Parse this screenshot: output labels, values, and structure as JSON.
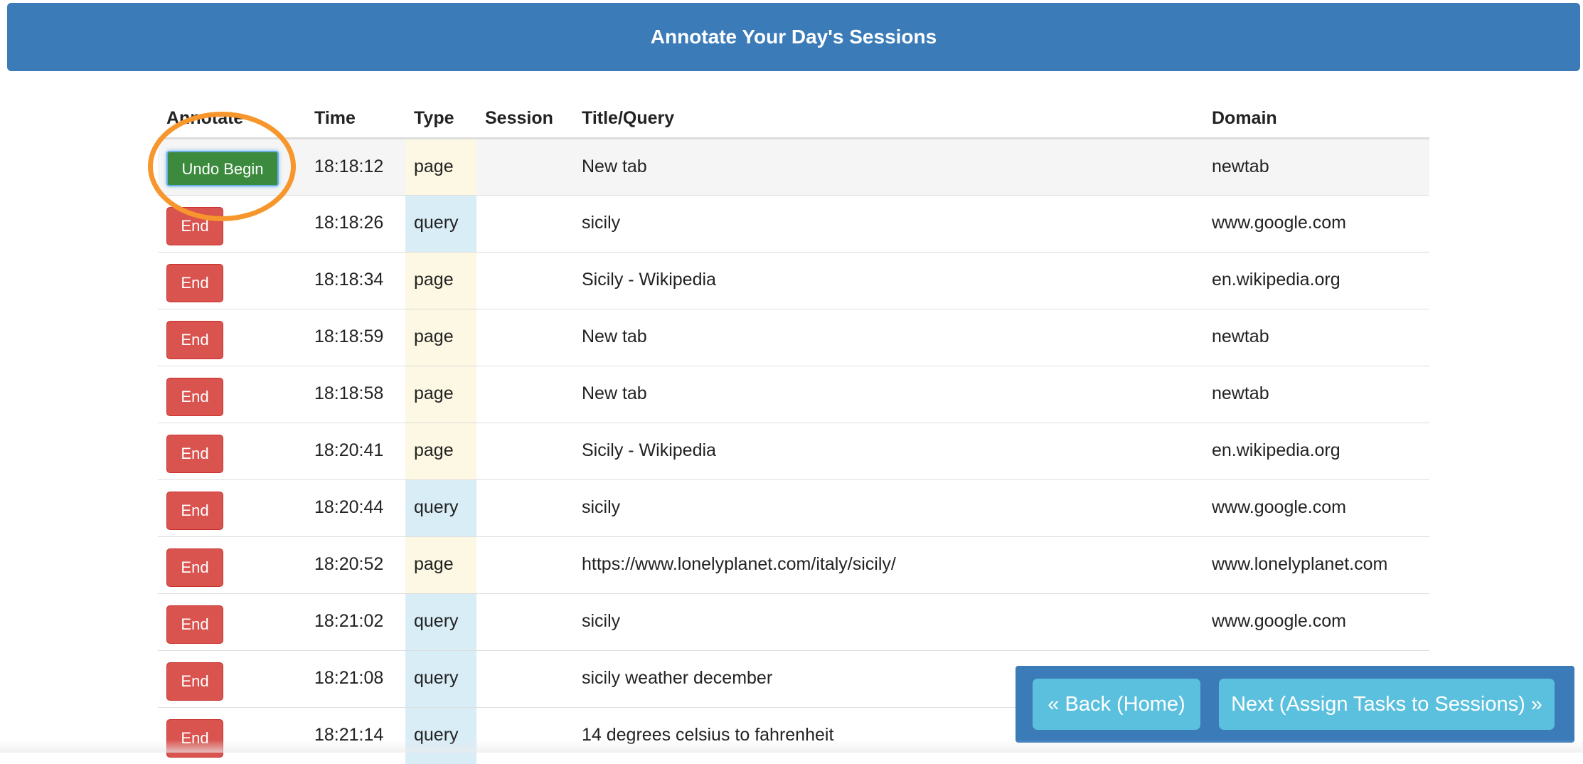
{
  "header": {
    "title": "Annotate Your Day's Sessions"
  },
  "table": {
    "columns": {
      "annotate": "Annotate",
      "time": "Time",
      "type": "Type",
      "session": "Session",
      "title": "Title/Query",
      "domain": "Domain"
    },
    "rows": [
      {
        "action": "Undo Begin",
        "time": "18:18:12",
        "type": "page",
        "session": "",
        "title": "New tab",
        "domain": "newtab"
      },
      {
        "action": "End",
        "time": "18:18:26",
        "type": "query",
        "session": "",
        "title": "sicily",
        "domain": "www.google.com"
      },
      {
        "action": "End",
        "time": "18:18:34",
        "type": "page",
        "session": "",
        "title": "Sicily - Wikipedia",
        "domain": "en.wikipedia.org"
      },
      {
        "action": "End",
        "time": "18:18:59",
        "type": "page",
        "session": "",
        "title": "New tab",
        "domain": "newtab"
      },
      {
        "action": "End",
        "time": "18:18:58",
        "type": "page",
        "session": "",
        "title": "New tab",
        "domain": "newtab"
      },
      {
        "action": "End",
        "time": "18:20:41",
        "type": "page",
        "session": "",
        "title": "Sicily - Wikipedia",
        "domain": "en.wikipedia.org"
      },
      {
        "action": "End",
        "time": "18:20:44",
        "type": "query",
        "session": "",
        "title": "sicily",
        "domain": "www.google.com"
      },
      {
        "action": "End",
        "time": "18:20:52",
        "type": "page",
        "session": "",
        "title": "https://www.lonelyplanet.com/italy/sicily/",
        "domain": "www.lonelyplanet.com"
      },
      {
        "action": "End",
        "time": "18:21:02",
        "type": "query",
        "session": "",
        "title": "sicily",
        "domain": "www.google.com"
      },
      {
        "action": "End",
        "time": "18:21:08",
        "type": "query",
        "session": "",
        "title": "sicily weather december",
        "domain": ""
      },
      {
        "action": "End",
        "time": "18:21:14",
        "type": "query",
        "session": "",
        "title": "14 degrees celsius to fahrenheit",
        "domain": ""
      }
    ]
  },
  "nav": {
    "back_label": "« Back (Home)",
    "next_label": "Next (Assign Tasks to Sessions) »"
  },
  "colors": {
    "header_bg": "#3a7bb8",
    "end_button": "#d9534f",
    "undo_button": "#3c8a3e",
    "page_cell": "#fcf8e3",
    "query_cell": "#d9edf7",
    "highlight_ring": "#f7962c",
    "nav_button": "#5bc0de"
  }
}
